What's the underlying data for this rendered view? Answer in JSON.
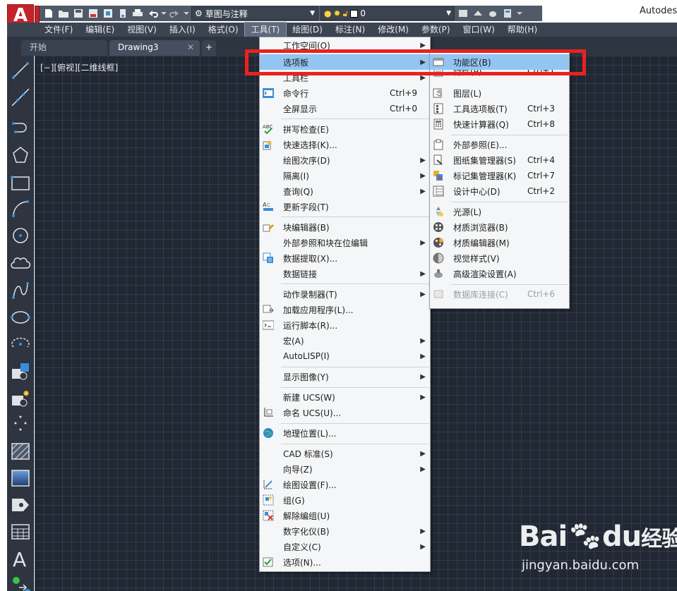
{
  "app": {
    "logo_letter": "A",
    "title": "Autodesk",
    "workspace": "草图与注释",
    "layer": "0"
  },
  "menubar": [
    {
      "label": "文件(F)"
    },
    {
      "label": "编辑(E)"
    },
    {
      "label": "视图(V)"
    },
    {
      "label": "插入(I)"
    },
    {
      "label": "格式(O)"
    },
    {
      "label": "工具(T)",
      "active": true
    },
    {
      "label": "绘图(D)"
    },
    {
      "label": "标注(N)"
    },
    {
      "label": "修改(M)"
    },
    {
      "label": "参数(P)"
    },
    {
      "label": "窗口(W)"
    },
    {
      "label": "帮助(H)"
    }
  ],
  "tabs": {
    "start": "开始",
    "drawing": "Drawing3",
    "close": "✕",
    "add": "+"
  },
  "viewport_label": "[−][俯视][二维线框]",
  "tools_menu": {
    "items": [
      {
        "label": "工作空间(O)",
        "submenu": true
      },
      {
        "label": "选项板",
        "submenu": true,
        "highlighted": true
      },
      {
        "label": "工具栏",
        "submenu": true
      },
      {
        "label": "命令行",
        "shortcut": "Ctrl+9",
        "icon": "command-line-icon"
      },
      {
        "label": "全屏显示",
        "shortcut": "Ctrl+0"
      },
      {
        "label": "拼写检查(E)",
        "icon": "spell-check-icon"
      },
      {
        "label": "快速选择(K)...",
        "icon": "quick-select-icon"
      },
      {
        "label": "绘图次序(D)",
        "submenu": true
      },
      {
        "label": "隔离(I)",
        "submenu": true
      },
      {
        "label": "查询(Q)",
        "submenu": true
      },
      {
        "label": "更新字段(T)",
        "icon": "update-field-icon"
      },
      {
        "label": "块编辑器(B)",
        "icon": "block-editor-icon"
      },
      {
        "label": "外部参照和块在位编辑",
        "submenu": true
      },
      {
        "label": "数据提取(X)...",
        "icon": "data-extraction-icon"
      },
      {
        "label": "数据链接",
        "submenu": true
      },
      {
        "label": "动作录制器(T)",
        "submenu": true
      },
      {
        "label": "加载应用程序(L)...",
        "icon": "load-app-icon"
      },
      {
        "label": "运行脚本(R)...",
        "icon": "run-script-icon"
      },
      {
        "label": "宏(A)",
        "submenu": true
      },
      {
        "label": "AutoLISP(I)",
        "submenu": true
      },
      {
        "label": "显示图像(Y)",
        "submenu": true
      },
      {
        "label": "新建 UCS(W)",
        "submenu": true
      },
      {
        "label": "命名 UCS(U)...",
        "icon": "named-ucs-icon"
      },
      {
        "label": "地理位置(L)...",
        "icon": "globe-icon"
      },
      {
        "label": "CAD 标准(S)",
        "submenu": true
      },
      {
        "label": "向导(Z)",
        "submenu": true
      },
      {
        "label": "绘图设置(F)...",
        "icon": "drafting-settings-icon"
      },
      {
        "label": "组(G)",
        "icon": "group-icon"
      },
      {
        "label": "解除编组(U)",
        "icon": "ungroup-icon"
      },
      {
        "label": "数字化仪(B)",
        "submenu": true
      },
      {
        "label": "自定义(C)",
        "submenu": true
      },
      {
        "label": "选项(N)...",
        "icon": "options-icon"
      }
    ]
  },
  "palettes_menu": {
    "items": [
      {
        "label": "功能区(B)",
        "highlighted": true,
        "icon": "ribbon-icon"
      },
      {
        "label": "特性(P)",
        "shortcut": "Ctrl+1",
        "icon": "properties-icon"
      },
      {
        "label": "图层(L)",
        "icon": "layers-icon"
      },
      {
        "label": "工具选项板(T)",
        "shortcut": "Ctrl+3",
        "icon": "tool-palettes-icon"
      },
      {
        "label": "快速计算器(Q)",
        "shortcut": "Ctrl+8",
        "icon": "calculator-icon"
      },
      {
        "label": "外部参照(E)...",
        "icon": "xref-icon"
      },
      {
        "label": "图纸集管理器(S)",
        "shortcut": "Ctrl+4",
        "icon": "sheet-set-icon"
      },
      {
        "label": "标记集管理器(K)",
        "shortcut": "Ctrl+7",
        "icon": "markup-set-icon"
      },
      {
        "label": "设计中心(D)",
        "shortcut": "Ctrl+2",
        "icon": "design-center-icon"
      },
      {
        "label": "光源(L)",
        "icon": "lights-icon"
      },
      {
        "label": "材质浏览器(B)",
        "icon": "materials-browser-icon"
      },
      {
        "label": "材质编辑器(M)",
        "icon": "materials-editor-icon"
      },
      {
        "label": "视觉样式(V)",
        "icon": "visual-styles-icon"
      },
      {
        "label": "高级渲染设置(A)",
        "icon": "render-settings-icon"
      },
      {
        "label": "数据库连接(C)",
        "shortcut": "Ctrl+6",
        "disabled": true,
        "icon": "db-connect-icon"
      }
    ]
  },
  "watermark": {
    "brand": "Bai",
    "brand_mid": "du",
    "brand_cn": "经验",
    "url": "jingyan.baidu.com"
  },
  "colors": {
    "menu_highlight": "#93c5f2",
    "annotation_red": "#e8231f",
    "canvas": "#212834",
    "menubar": "#3d4451"
  }
}
